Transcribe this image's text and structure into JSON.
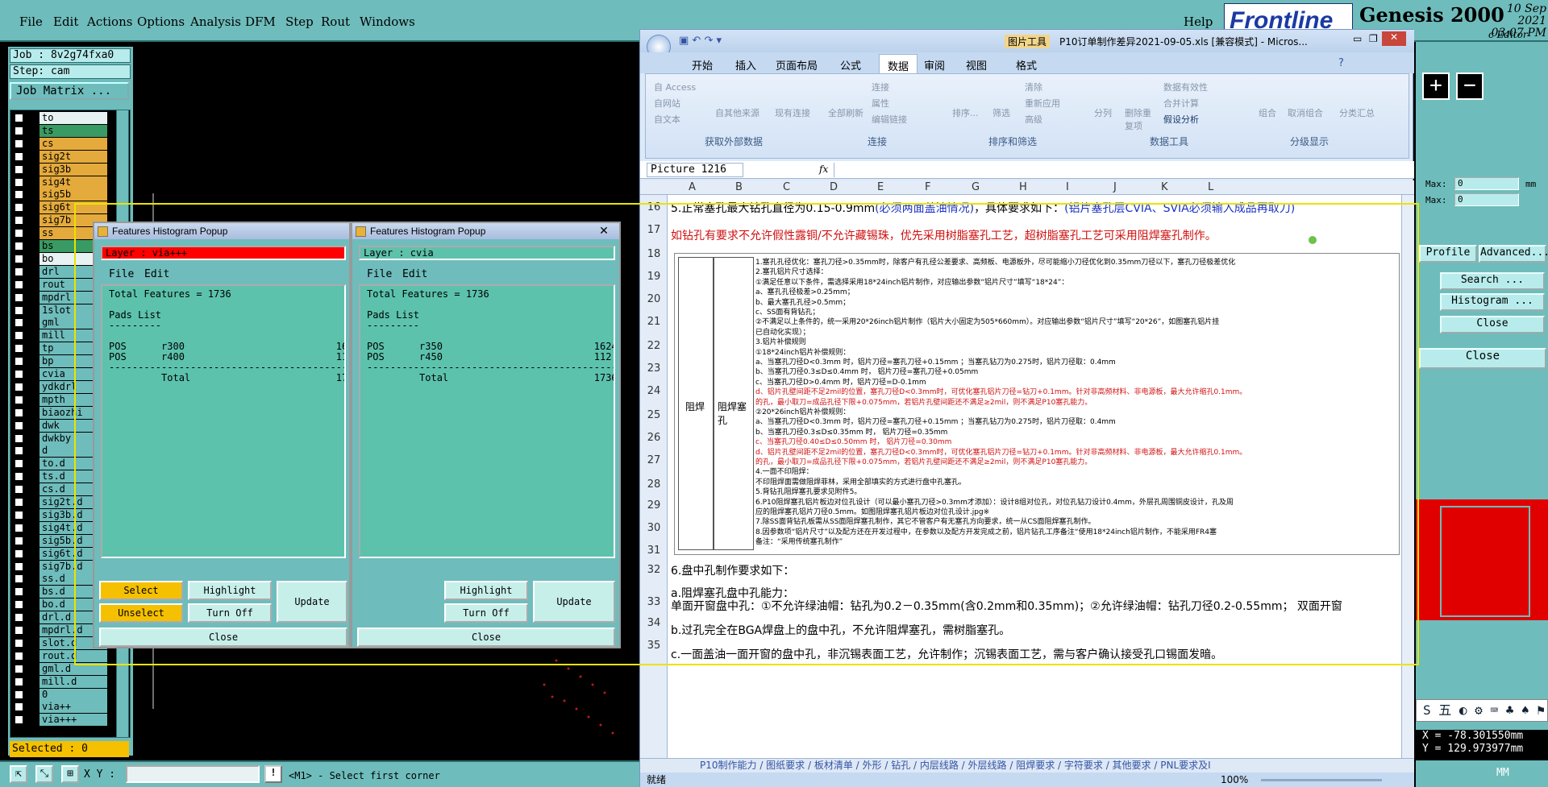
{
  "genesis": {
    "menu": [
      "File",
      "Edit",
      "Actions",
      "Options",
      "Analysis",
      "DFM",
      "Step",
      "Rout",
      "Windows"
    ],
    "help": "Help",
    "brand": "Frontline",
    "product": "Genesis 2000",
    "date": "10 Sep 2021",
    "time": "03:07 PM",
    "subtitle": "c Editor",
    "job_label": "Job : 8v2g74fxa0",
    "step_label": "Step: cam",
    "job_matrix": "Job Matrix ...",
    "layers": [
      {
        "name": "to",
        "color": "white"
      },
      {
        "name": "ts",
        "color": "green"
      },
      {
        "name": "cs",
        "color": "orange"
      },
      {
        "name": "sig2t",
        "color": "orange"
      },
      {
        "name": "sig3b",
        "color": "orange"
      },
      {
        "name": "sig4t",
        "color": "orange"
      },
      {
        "name": "sig5b",
        "color": "orange"
      },
      {
        "name": "sig6t",
        "color": "orange"
      },
      {
        "name": "sig7b",
        "color": "orange"
      },
      {
        "name": "ss",
        "color": "orange"
      },
      {
        "name": "bs",
        "color": "green"
      },
      {
        "name": "bo",
        "color": "white"
      },
      {
        "name": "drl",
        "color": "teal"
      },
      {
        "name": "rout",
        "color": "teal"
      },
      {
        "name": "mpdrl",
        "color": "teal"
      },
      {
        "name": "1slot",
        "color": "teal"
      },
      {
        "name": "gml",
        "color": "teal"
      },
      {
        "name": "mill",
        "color": "teal"
      },
      {
        "name": "tp",
        "color": "teal"
      },
      {
        "name": "bp",
        "color": "teal"
      },
      {
        "name": "cvia",
        "color": "teal"
      },
      {
        "name": "ydkdrl",
        "color": "teal"
      },
      {
        "name": "mpth",
        "color": "teal"
      },
      {
        "name": "biaozhi",
        "color": "teal"
      },
      {
        "name": "dwk",
        "color": "teal"
      },
      {
        "name": "dwkby",
        "color": "teal"
      },
      {
        "name": "d",
        "color": "teal"
      },
      {
        "name": "to.d",
        "color": "teal"
      },
      {
        "name": "ts.d",
        "color": "teal"
      },
      {
        "name": "cs.d",
        "color": "teal"
      },
      {
        "name": "sig2t.d",
        "color": "teal"
      },
      {
        "name": "sig3b.d",
        "color": "teal"
      },
      {
        "name": "sig4t.d",
        "color": "teal"
      },
      {
        "name": "sig5b.d",
        "color": "teal"
      },
      {
        "name": "sig6t.d",
        "color": "teal"
      },
      {
        "name": "sig7b.d",
        "color": "teal"
      },
      {
        "name": "ss.d",
        "color": "teal"
      },
      {
        "name": "bs.d",
        "color": "teal"
      },
      {
        "name": "bo.d",
        "color": "teal"
      },
      {
        "name": "drl.d",
        "color": "teal"
      },
      {
        "name": "mpdrl.d",
        "color": "teal"
      },
      {
        "name": "slot.d",
        "color": "teal"
      },
      {
        "name": "rout.d",
        "color": "teal"
      },
      {
        "name": "gml.d",
        "color": "teal"
      },
      {
        "name": "mill.d",
        "color": "teal"
      },
      {
        "name": "0",
        "color": "teal"
      },
      {
        "name": "via++",
        "color": "teal"
      },
      {
        "name": "via+++",
        "color": "teal"
      }
    ],
    "selected": "Selected : 0",
    "xy_label": "X Y :",
    "hint": "<M1> - Select first corner",
    "right": {
      "max1_label": "Max:",
      "max1_value": "0",
      "max1_unit": "mm",
      "max2_label": "Max:",
      "max2_value": "0",
      "profile": "Profile",
      "advanced": "Advanced...",
      "search": "Search ...",
      "histogram": "Histogram ...",
      "close1": "Close",
      "close2": "Close",
      "x_coord": "X =  -78.301550mm",
      "y_coord": "Y =  129.973977mm",
      "mm": "MM",
      "ime": "S 五 ◐ ⚙ ⌨ ♣ ♠ ⚑"
    }
  },
  "popup1": {
    "title": "Features Histogram Popup",
    "layer": "Layer :  via+++",
    "menu_file": "File",
    "menu_edit": "Edit",
    "text": "Total Features = 1736\n\nPads List\n---------\n\nPOS      r300                          1624\nPOS      r400                          112\n--------------------------------------------\n         Total                         1736",
    "select": "Select",
    "unselect": "Unselect",
    "highlight": "Highlight",
    "turnoff": "Turn Off",
    "update": "Update",
    "close": "Close"
  },
  "popup2": {
    "title": "Features Histogram Popup",
    "layer": "Layer :  cvia",
    "menu_file": "File",
    "menu_edit": "Edit",
    "text": "Total Features = 1736\n\nPads List\n---------\n\nPOS      r350                          1624\nPOS      r450                          112\n--------------------------------------------\n         Total                         1736",
    "highlight": "Highlight",
    "turnoff": "Turn Off",
    "update": "Update",
    "close": "Close"
  },
  "excel": {
    "title": "P10订单制作差异2021-09-05.xls [兼容模式] - Micros...",
    "pic_tools": "图片工具",
    "tabs": [
      "开始",
      "插入",
      "页面布局",
      "公式",
      "数据",
      "审阅",
      "视图",
      "格式"
    ],
    "active_tab": "数据",
    "ribbon": {
      "g1": "获取外部数据",
      "g2": "连接",
      "g3": "排序和筛选",
      "g4": "数据工具",
      "g5": "分级显示",
      "access": "自 Access",
      "web": "自网站",
      "text": "自文本",
      "other": "自其他来源",
      "existing": "现有连接",
      "refresh": "全部刷新",
      "conn": "连接",
      "props": "属性",
      "edit_links": "编辑链接",
      "sort": "排序...",
      "filter": "筛选",
      "clear": "清除",
      "reapply": "重新应用",
      "advanced": "高级",
      "split": "分列",
      "remove_dup": "删除重复项",
      "validation": "数据有效性",
      "consolidate": "合并计算",
      "whatif": "假设分析",
      "group": "组合",
      "ungroup": "取消组合",
      "subtotal": "分类汇总"
    },
    "namebox": "Picture 1216",
    "fx": "fx",
    "columns": [
      "A",
      "B",
      "C",
      "D",
      "E",
      "F",
      "G",
      "H",
      "I",
      "J",
      "K",
      "L"
    ],
    "rows": [
      "16",
      "17",
      "18",
      "19",
      "20",
      "21",
      "22",
      "23",
      "24",
      "25",
      "26",
      "27",
      "28",
      "29",
      "30",
      "31",
      "32",
      "33",
      "34",
      "35"
    ],
    "row16_a": "5.正常塞孔最大钻孔直径为0.15-0.9mm",
    "row16_b": "(必须两面盖油情况)",
    "row16_c": "，具体要求如下：",
    "row16_d": "(铝片塞孔层CVIA、SVIA必须输入成品再取刀)",
    "row17": "如钻孔有要求不允许假性露铜/不允许藏锡珠，优先采用树脂塞孔工艺，超树脂塞孔工艺可采用阻焊塞孔制作。",
    "row32": "6.盘中孔制作要求如下：",
    "row33a": "a.阻焊塞孔盘中孔能力：",
    "row33b": "单面开窗盘中孔：①不允许绿油帽：钻孔为0.2－0.35mm(含0.2mm和0.35mm)；②允许绿油帽：钻孔刀径0.2-0.55mm；    双面开窗",
    "row34": "b.过孔完全在BGA焊盘上的盘中孔，不允许阻焊塞孔，需树脂塞孔。",
    "row35": "c.一面盖油一面开窗的盘中孔，非沉锡表面工艺，允许制作；沉锡表面工艺，需与客户确认接受孔口锡面发暗。",
    "pic_col1": "阻焊",
    "pic_col2": "阻焊塞孔",
    "pic_lines": [
      {
        "t": "1.塞孔孔径优化：塞孔刀径>0.35mm时，除客户有孔径公差要求、高频板、电源板外，尽可能缩小刀径优化到0.35mm刀径以下，塞孔刀径极差优化",
        "red": false
      },
      {
        "t": "2.塞孔铝片尺寸选择：",
        "red": false
      },
      {
        "t": "①满足任意以下条件，需选择采用18*24inch铝片制作，对应输出参数“铝片尺寸”填写“18*24”：",
        "red": false
      },
      {
        "t": "a、塞孔孔径极差>0.25mm；",
        "red": false
      },
      {
        "t": "b、最大塞孔孔径>0.5mm；",
        "red": false
      },
      {
        "t": "c、SS面有背钻孔；",
        "red": false
      },
      {
        "t": "②不满足以上条件的，统一采用20*26inch铝片制作（铝片大小固定为505*660mm）。对应输出参数“铝片尺寸”填写“20*26”，如图塞孔铝片挂",
        "red": false
      },
      {
        "t": "已自动化实现）；",
        "red": false
      },
      {
        "t": "3.铝片补偿规则",
        "red": false
      },
      {
        "t": "①18*24inch铝片补偿规则：",
        "red": false
      },
      {
        "t": "a、当塞孔刀径D<0.3mm 时，铝片刀径=塞孔刀径+0.15mm ；当塞孔钻刀为0.275时，铝片刀径取：0.4mm",
        "red": false
      },
      {
        "t": "b、当塞孔刀径0.3≤D≤0.4mm 时， 铝片刀径=塞孔刀径+0.05mm",
        "red": false
      },
      {
        "t": "c、当塞孔刀径D>0.4mm 时，铝片刀径=D-0.1mm",
        "red": false
      },
      {
        "t": "d、铝片孔壁间距不足2mil的位置，塞孔刀径D<0.3mm时，可优化塞孔铝片刀径=钻刀+0.1mm。针对非高频材料、非电源板，最大允许缩孔0.1mm。",
        "red": true
      },
      {
        "t": "的孔，最小取刀=成品孔径下限+0.075mm，若铝片孔壁间距还不满足≥2mil，则不满足P10塞孔能力。",
        "red": true
      },
      {
        "t": "②20*26inch铝片补偿规则：",
        "red": false
      },
      {
        "t": "a、当塞孔刀径D<0.3mm 时，铝片刀径=塞孔刀径+0.15mm ；当塞孔钻刀为0.275时，铝片刀径取：0.4mm",
        "red": false
      },
      {
        "t": "b、当塞孔刀径0.3≤D≤0.35mm 时， 铝片刀径=0.35mm",
        "red": false
      },
      {
        "t": "c、当塞孔刀径0.40≤D≤0.50mm 时， 铝片刀径=0.30mm",
        "red": true
      },
      {
        "t": "d、铝片孔壁间距不足2mil的位置，塞孔刀径D<0.3mm时，可优化塞孔铝片刀径=钻刀+0.1mm。针对非高频材料、非电源板，最大允许缩孔0.1mm。",
        "red": true
      },
      {
        "t": "的孔，最小取刀=成品孔径下限+0.075mm，若铝片孔壁间距还不满足≥2mil，则不满足P10塞孔能力。",
        "red": true
      },
      {
        "t": "4.一面不印阻焊：",
        "red": false
      },
      {
        "t": "不印阻焊面需做阻焊菲林，采用全部填实的方式进行盘中孔塞孔。",
        "red": false
      },
      {
        "t": "5.背钻孔阻焊塞孔要求见附件5。",
        "red": false
      },
      {
        "t": "6.P10阻焊塞孔铝片板边对位孔设计（可以最小塞孔刀径>0.3mm才添加）：设计8组对位孔，对位孔钻刀设计0.4mm，外层孔周围铜皮设计，孔及周",
        "red": false
      },
      {
        "t": "应的阻焊塞孔铝片刀径0.5mm。如图阻焊塞孔铝片板边对位孔设计.jpg※",
        "red": false
      },
      {
        "t": "7.除SS面背钻孔板需从SS面阻焊塞孔制作，其它不管客户有无塞孔方向要求，统一从CS面阻焊塞孔制作。",
        "red": false
      },
      {
        "t": "8.因参数项“铝片尺寸”以及配方还在开发过程中，在参数以及配方开发完成之前，铝片钻孔工序备注“使用18*24inch铝片制作，不能采用FR4塞",
        "red": false
      },
      {
        "t": "备注：“采用传统塞孔制作”",
        "red": false
      }
    ],
    "sheet_tabs": "P10制作能力 / 图纸要求 / 板材清单 / 外形 / 钻孔 / 内层线路 / 外层线路 / 阻焊要求 / 字符要求 / 其他要求 / PNL要求及I",
    "status_ready": "就绪",
    "zoom": "100%"
  }
}
